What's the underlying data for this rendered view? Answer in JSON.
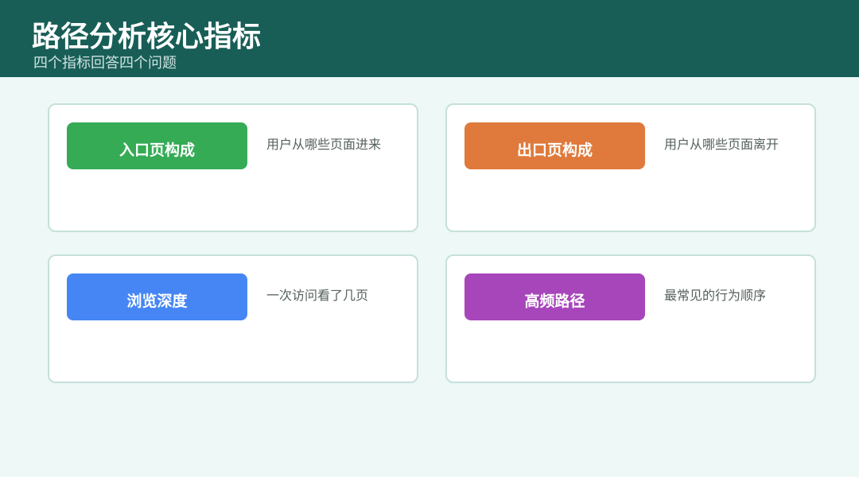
{
  "header": {
    "title": "路径分析核心指标",
    "subtitle": "四个指标回答四个问题"
  },
  "cards": [
    {
      "label": "入口页构成",
      "description": "用户从哪些页面进来",
      "color": "#35ab55"
    },
    {
      "label": "出口页构成",
      "description": "用户从哪些页面离开",
      "color": "#df7a3c"
    },
    {
      "label": "浏览深度",
      "description": "一次访问看了几页",
      "color": "#4586f4"
    },
    {
      "label": "高频路径",
      "description": "最常见的行为顺序",
      "color": "#a746ba"
    }
  ],
  "colors": {
    "header_bg": "#185e57",
    "page_bg": "#eef8f6",
    "card_border": "#c5e0da"
  }
}
